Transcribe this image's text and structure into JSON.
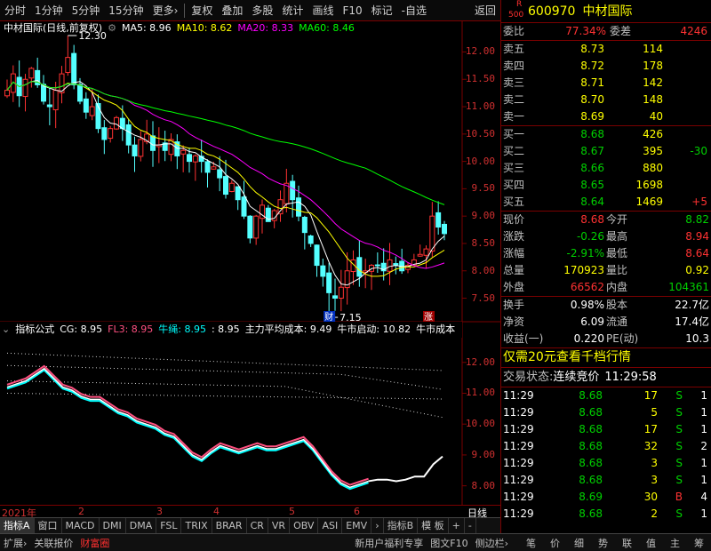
{
  "toolbar": {
    "items": [
      "分时",
      "1分钟",
      "5分钟",
      "15分钟",
      "更多›",
      "复权",
      "叠加",
      "多股",
      "统计",
      "画线",
      "F10",
      "标记",
      "-自选",
      "返回"
    ]
  },
  "main_info": {
    "title": "中材国际(日线,前复权)",
    "ma5": "MA5: 8.96",
    "ma10": "MA10: 8.62",
    "ma20": "MA20: 8.33",
    "ma60": "MA60: 8.46"
  },
  "indicator_info": {
    "name": "指标公式",
    "cg": "CG: 8.95",
    "fl3": "FL3: 8.95",
    "niushen": "牛绳: 8.95",
    "v": ": 8.95",
    "cost": "主力平均成本: 9.49",
    "start": "牛市启动: 10.82",
    "end": "牛市成本"
  },
  "main_axis": [
    "12.00",
    "11.50",
    "11.00",
    "10.50",
    "10.00",
    "9.50",
    "9.00",
    "8.50",
    "8.00",
    "7.50"
  ],
  "ind_axis": [
    "12.00",
    "11.00",
    "10.00",
    "9.00",
    "8.00"
  ],
  "annotations": {
    "high": "12.30",
    "low": "7.15",
    "cai": "财",
    "zhang": "涨"
  },
  "x_axis": [
    "2021年",
    "2",
    "3",
    "4",
    "5",
    "6"
  ],
  "x_right": "日线",
  "tabs": [
    "指标A",
    "窗口",
    "MACD",
    "DMI",
    "DMA",
    "FSL",
    "TRIX",
    "BRAR",
    "CR",
    "VR",
    "OBV",
    "ASI",
    "EMV",
    "›",
    "指标B",
    "模 板",
    "+",
    "-"
  ],
  "bottom": [
    "扩展›",
    "关联报价",
    "财富圈",
    "新用户福利专享",
    "图文F10",
    "侧边栏›",
    "笔",
    "价",
    "细",
    "势",
    "联",
    "值",
    "主",
    "筹"
  ],
  "stock": {
    "tag_r": "R",
    "tag_500": "500",
    "code": "600970",
    "name": "中材国际"
  },
  "weibi": {
    "label1": "委比",
    "val1": "77.34%",
    "label2": "委差",
    "val2": "4246"
  },
  "sells": [
    {
      "label": "卖五",
      "price": "8.73",
      "vol": "114"
    },
    {
      "label": "卖四",
      "price": "8.72",
      "vol": "178"
    },
    {
      "label": "卖三",
      "price": "8.71",
      "vol": "142"
    },
    {
      "label": "卖二",
      "price": "8.70",
      "vol": "148"
    },
    {
      "label": "卖一",
      "price": "8.69",
      "vol": "40"
    }
  ],
  "buys": [
    {
      "label": "买一",
      "price": "8.68",
      "vol": "426",
      "chg": ""
    },
    {
      "label": "买二",
      "price": "8.67",
      "vol": "395",
      "chg": "-30"
    },
    {
      "label": "买三",
      "price": "8.66",
      "vol": "880",
      "chg": ""
    },
    {
      "label": "买四",
      "price": "8.65",
      "vol": "1698",
      "chg": ""
    },
    {
      "label": "买五",
      "price": "8.64",
      "vol": "1469",
      "chg": "+5"
    }
  ],
  "quote": [
    {
      "l1": "现价",
      "v1": "8.68",
      "l2": "今开",
      "v2": "8.82"
    },
    {
      "l1": "涨跌",
      "v1": "-0.26",
      "l2": "最高",
      "v2": "8.94"
    },
    {
      "l1": "涨幅",
      "v1": "-2.91%",
      "l2": "最低",
      "v2": "8.64"
    },
    {
      "l1": "总量",
      "v1": "170923",
      "l2": "量比",
      "v2": "0.92"
    },
    {
      "l1": "外盘",
      "v1": "66562",
      "l2": "内盘",
      "v2": "104361"
    }
  ],
  "fund": [
    {
      "l1": "换手",
      "v1": "0.98%",
      "l2": "股本",
      "v2": "22.7亿"
    },
    {
      "l1": "净资",
      "v1": "6.09",
      "l2": "流通",
      "v2": "17.4亿"
    },
    {
      "l1": "收益(一)",
      "v1": "0.220",
      "l2": "PE(动)",
      "v2": "10.3"
    }
  ],
  "promo": "仅需20元查看千档行情",
  "status": {
    "label": "交易状态:",
    "state": "连续竞价",
    "time": "11:29:58"
  },
  "ticks": [
    {
      "t": "11:29",
      "p": "8.68",
      "v": "17",
      "d": "S",
      "n": "1"
    },
    {
      "t": "11:29",
      "p": "8.68",
      "v": "5",
      "d": "S",
      "n": "1"
    },
    {
      "t": "11:29",
      "p": "8.68",
      "v": "17",
      "d": "S",
      "n": "1"
    },
    {
      "t": "11:29",
      "p": "8.68",
      "v": "32",
      "d": "S",
      "n": "2"
    },
    {
      "t": "11:29",
      "p": "8.68",
      "v": "3",
      "d": "S",
      "n": "1"
    },
    {
      "t": "11:29",
      "p": "8.68",
      "v": "3",
      "d": "S",
      "n": "1"
    },
    {
      "t": "11:29",
      "p": "8.69",
      "v": "30",
      "d": "B",
      "n": "4"
    },
    {
      "t": "11:29",
      "p": "8.68",
      "v": "2",
      "d": "S",
      "n": "1"
    }
  ],
  "chart_data": [
    {
      "type": "candlestick",
      "title": "中材国际(日线,前复权)",
      "ylim": [
        7.2,
        12.3
      ],
      "close": [
        11.3,
        11.6,
        11.2,
        11.5,
        11.7,
        11.4,
        11.1,
        11.0,
        11.3,
        11.6,
        11.9,
        11.4,
        11.1,
        10.9,
        11.0,
        10.6,
        10.4,
        10.6,
        10.8,
        10.6,
        10.3,
        10.1,
        10.4,
        10.5,
        10.2,
        10.3,
        10.2,
        10.4,
        10.1,
        10.2,
        10.0,
        10.1,
        10.0,
        9.8,
        9.9,
        9.7,
        9.4,
        9.6,
        9.3,
        9.0,
        8.6,
        9.0,
        9.2,
        8.9,
        9.1,
        9.3,
        9.6,
        9.3,
        9.0,
        8.7,
        8.5,
        8.1,
        7.9,
        7.6,
        7.5,
        7.7,
        8.0,
        8.2,
        7.9,
        8.0,
        8.1,
        8.1,
        8.0,
        8.2,
        8.1,
        8.0,
        8.1,
        8.2,
        8.3,
        8.4,
        9.0,
        8.8,
        8.68
      ],
      "series": [
        {
          "name": "MA5"
        },
        {
          "name": "MA10"
        },
        {
          "name": "MA20"
        },
        {
          "name": "MA60"
        }
      ]
    },
    {
      "type": "line",
      "title": "指标公式",
      "ylim": [
        7.5,
        12.8
      ],
      "series": [
        {
          "name": "CG",
          "values": [
            11.2,
            11.3,
            11.4,
            11.6,
            11.8,
            11.5,
            11.2,
            11.1,
            10.9,
            10.8,
            10.8,
            10.6,
            10.4,
            10.3,
            10.1,
            10.0,
            9.9,
            9.7,
            9.6,
            9.3,
            9.0,
            8.85,
            9.1,
            9.3,
            9.2,
            9.1,
            9.2,
            9.3,
            9.2,
            9.2,
            9.3,
            9.4,
            9.5,
            9.2,
            8.8,
            8.4,
            8.1,
            7.95,
            8.05,
            8.15,
            8.2,
            8.2,
            8.15,
            8.2,
            8.3,
            8.3,
            8.7,
            8.95
          ]
        }
      ]
    }
  ]
}
